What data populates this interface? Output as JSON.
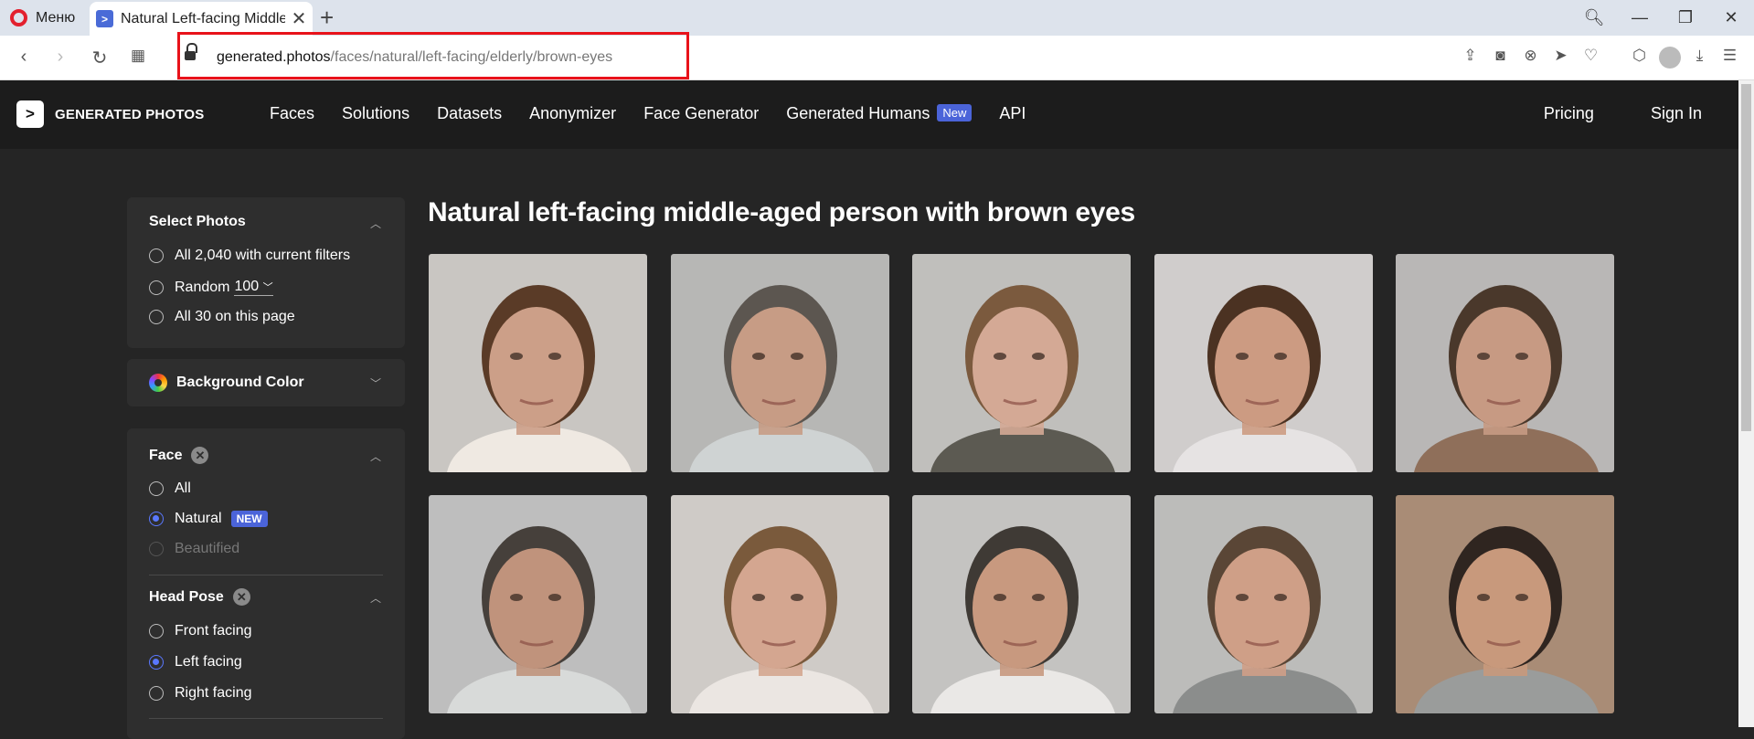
{
  "browser": {
    "menu_label": "Меню",
    "tab_title": "Natural Left-facing Middle-aged Person With Brown Eyes",
    "url_host": "generated.photos",
    "url_path": "/faces/natural/left-facing/elderly/brown-eyes"
  },
  "site": {
    "brand_logo": ">",
    "brand_name": "GENERATED PHOTOS",
    "nav": [
      "Faces",
      "Solutions",
      "Datasets",
      "Anonymizer",
      "Face Generator",
      "Generated Humans",
      "API"
    ],
    "nav_new_badge": "New",
    "pricing": "Pricing",
    "sign_in": "Sign In"
  },
  "sidebar": {
    "select_title": "Select Photos",
    "select_all": "All 2,040 with current filters",
    "random_label": "Random",
    "random_value": "100",
    "all_page": "All 30 on this page",
    "bg_title": "Background Color",
    "face_title": "Face",
    "face_options": [
      "All",
      "Natural",
      "Beautified"
    ],
    "face_new_badge": "NEW",
    "head_title": "Head Pose",
    "head_options": [
      "Front facing",
      "Left facing",
      "Right facing"
    ]
  },
  "main": {
    "title": "Natural left-facing middle-aged person with brown eyes"
  },
  "photos": [
    {
      "bg": "#c9c6c2",
      "skin": "#cc9f88",
      "hair": "#5a3b27",
      "shirt": "#efe9e2"
    },
    {
      "bg": "#b7b7b5",
      "skin": "#c79c85",
      "hair": "#5c5650",
      "shirt": "#cfd3d3"
    },
    {
      "bg": "#c0bfbc",
      "skin": "#d4a995",
      "hair": "#7b5a3e",
      "shirt": "#5c5a52"
    },
    {
      "bg": "#d0cdcc",
      "skin": "#cc9b82",
      "hair": "#4b3222",
      "shirt": "#e6e3e3"
    },
    {
      "bg": "#b9b7b6",
      "skin": "#c79a83",
      "hair": "#4a382b",
      "shirt": "#8f6f5a"
    },
    {
      "bg": "#bebebe",
      "skin": "#c0937c",
      "hair": "#46403b",
      "shirt": "#d8dad9"
    },
    {
      "bg": "#cfcbc7",
      "skin": "#d4a690",
      "hair": "#7a5a3c",
      "shirt": "#ebe6e2"
    },
    {
      "bg": "#c4c3c1",
      "skin": "#c8997f",
      "hair": "#3f3a35",
      "shirt": "#eae8e6"
    },
    {
      "bg": "#bcbcba",
      "skin": "#cf9f87",
      "hair": "#5a4636",
      "shirt": "#8b8d8c"
    },
    {
      "bg": "#a98c76",
      "skin": "#c8997c",
      "hair": "#2f2520",
      "shirt": "#9a9c9b"
    }
  ]
}
